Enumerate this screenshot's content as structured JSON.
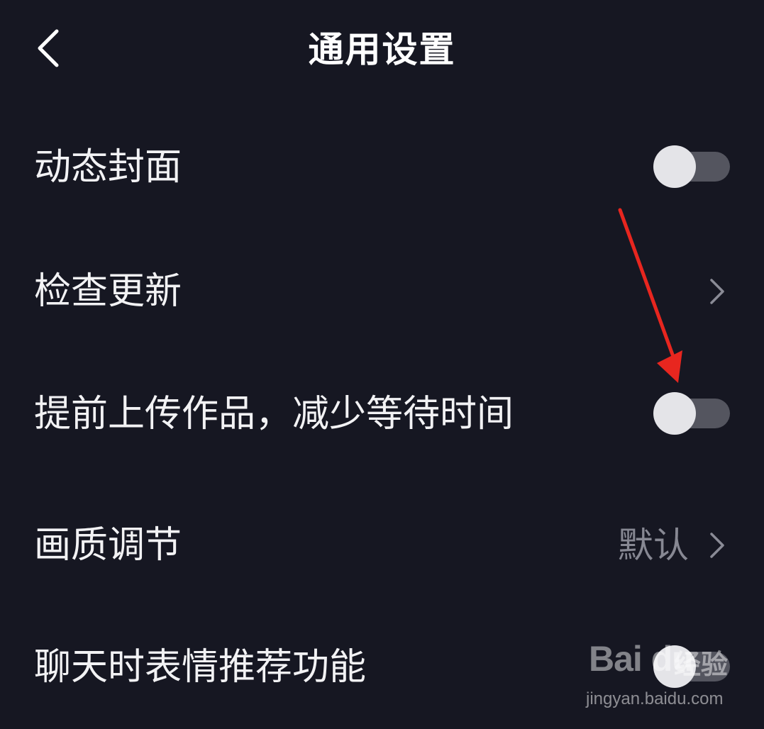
{
  "header": {
    "title": "通用设置",
    "back_icon": "chevron-left-icon"
  },
  "settings": [
    {
      "label": "动态封面",
      "control": "toggle",
      "state": "off"
    },
    {
      "label": "检查更新",
      "control": "chevron"
    },
    {
      "label": "提前上传作品，减少等待时间",
      "control": "toggle",
      "state": "off"
    },
    {
      "label": "画质调节",
      "control": "chevron",
      "value": "默认"
    },
    {
      "label": "聊天时表情推荐功能",
      "control": "toggle",
      "state": "off"
    }
  ],
  "annotation": {
    "icon": "red-arrow-icon",
    "color": "#e8261f"
  },
  "watermark": {
    "logo_text": "Bai du",
    "brand_cn": "经验",
    "url": "jingyan.baidu.com"
  },
  "colors": {
    "background": "#161722",
    "toggle_track": "#54555f",
    "toggle_knob": "#e4e4e8",
    "secondary_text": "#878893"
  }
}
